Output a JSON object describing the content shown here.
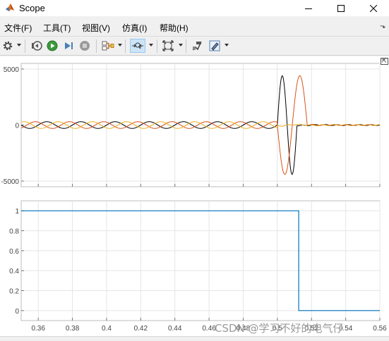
{
  "window": {
    "title": "Scope",
    "min_glyph": "—",
    "max_glyph": "☐",
    "close_glyph": "✕"
  },
  "menu": {
    "items": [
      "文件(F)",
      "工具(T)",
      "视图(V)",
      "仿真(I)",
      "帮助(H)"
    ],
    "overflow_glyph": "⬎"
  },
  "toolbar": {
    "icons": [
      "gear-icon",
      "rewind-step-icon",
      "run-icon",
      "step-forward-icon",
      "stop-icon",
      "signal-selector-icon",
      "zoom-time-icon",
      "fit-to-view-icon",
      "cursor-measure-icon",
      "highlight-icon"
    ]
  },
  "undock_glyph": "⇱",
  "colors": {
    "series1": "#000000",
    "series2": "#d95319",
    "series3": "#edb120",
    "series4": "#0072bd",
    "grid": "#e5e5e5"
  },
  "chart_data": [
    {
      "type": "line",
      "x_range": [
        0.35,
        0.56
      ],
      "ylim": [
        -5500,
        5500
      ],
      "y_ticks": [
        "5000",
        "0",
        "-5000"
      ],
      "y_tick_values": [
        5000,
        0,
        -5000
      ],
      "grid": true,
      "series": [
        {
          "color": "#000000",
          "steady_amplitude": 300,
          "phase_deg": 0,
          "pulse": {
            "t_start": 0.5,
            "t_end": 0.5115,
            "peak": 4400
          }
        },
        {
          "color": "#d95319",
          "steady_amplitude": 300,
          "phase_deg": 120,
          "pulse": {
            "t_start": 0.5,
            "t_end": 0.5175,
            "peak": 4400
          }
        },
        {
          "color": "#edb120",
          "steady_amplitude": 300,
          "phase_deg": 240,
          "pulse": null
        }
      ],
      "fault_time": 0.5,
      "frequency_hz": 50
    },
    {
      "type": "line",
      "x_range": [
        0.35,
        0.56
      ],
      "ylim": [
        -0.1,
        1.1
      ],
      "y_ticks": [
        "1",
        "0.8",
        "0.6",
        "0.4",
        "0.2",
        "0"
      ],
      "y_tick_values": [
        1,
        0.8,
        0.6,
        0.4,
        0.2,
        0
      ],
      "x_ticks": [
        "0.36",
        "0.38",
        "0.4",
        "0.42",
        "0.44",
        "0.46",
        "0.48",
        "0.5",
        "0.52",
        "0.54",
        "0.56"
      ],
      "x_tick_values": [
        0.36,
        0.38,
        0.4,
        0.42,
        0.44,
        0.46,
        0.48,
        0.5,
        0.52,
        0.54,
        0.56
      ],
      "grid": true,
      "series": [
        {
          "color": "#0072bd",
          "x": [
            0.35,
            0.5125,
            0.5125,
            0.56
          ],
          "y": [
            1,
            1,
            0,
            0
          ]
        }
      ]
    }
  ],
  "watermark": "CSDN @学习不好的电气仔"
}
